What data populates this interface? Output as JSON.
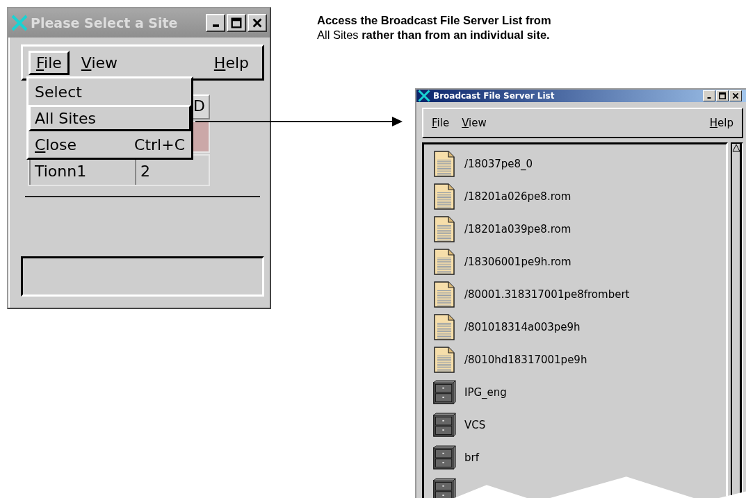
{
  "site_window": {
    "title": "Please Select a Site",
    "menubar": [
      {
        "label": "File",
        "mnemonic": true,
        "selected": true
      },
      {
        "label": "View",
        "mnemonic": true,
        "selected": false
      },
      {
        "label": "Help",
        "mnemonic": true,
        "selected": false
      }
    ],
    "dropdown": [
      {
        "label": "Select",
        "mnemonic": false,
        "selected": false
      },
      {
        "label": "All Sites",
        "mnemonic": false,
        "selected": true
      },
      {
        "label": "Close",
        "shortcut": "Ctrl+C",
        "mnemonic": true,
        "selected": false
      }
    ],
    "table": {
      "column_2": "D",
      "rows": [
        {
          "selected": true
        },
        {
          "selected": false,
          "cells": [
            "Tionn1",
            "2"
          ]
        }
      ]
    }
  },
  "callout": "**Access the Broadcast File Server List from** All Sites **rather than from an individual site.**",
  "server_window": {
    "title": "Broadcast File Server List",
    "menubar": [
      {
        "label": "File",
        "mnemonic": true,
        "selected": false
      },
      {
        "label": "View",
        "mnemonic": true,
        "selected": false
      },
      {
        "label": "Help",
        "mnemonic": true,
        "selected": false
      }
    ],
    "items": [
      {
        "kind": "file",
        "name": "/18037pe8_0"
      },
      {
        "kind": "file",
        "name": "/18201a026pe8.rom"
      },
      {
        "kind": "file",
        "name": "/18201a039pe8.rom"
      },
      {
        "kind": "file",
        "name": "/18306001pe9h.rom"
      },
      {
        "kind": "file",
        "name": "/80001.318317001pe8frombert"
      },
      {
        "kind": "file",
        "name": "/801018314a003pe9h"
      },
      {
        "kind": "file",
        "name": "/8010hd18317001pe9h"
      },
      {
        "kind": "drawer",
        "name": "IPG_eng"
      },
      {
        "kind": "drawer",
        "name": "VCS"
      },
      {
        "kind": "drawer",
        "name": "brf"
      },
      {
        "kind": "drawer"
      }
    ]
  }
}
